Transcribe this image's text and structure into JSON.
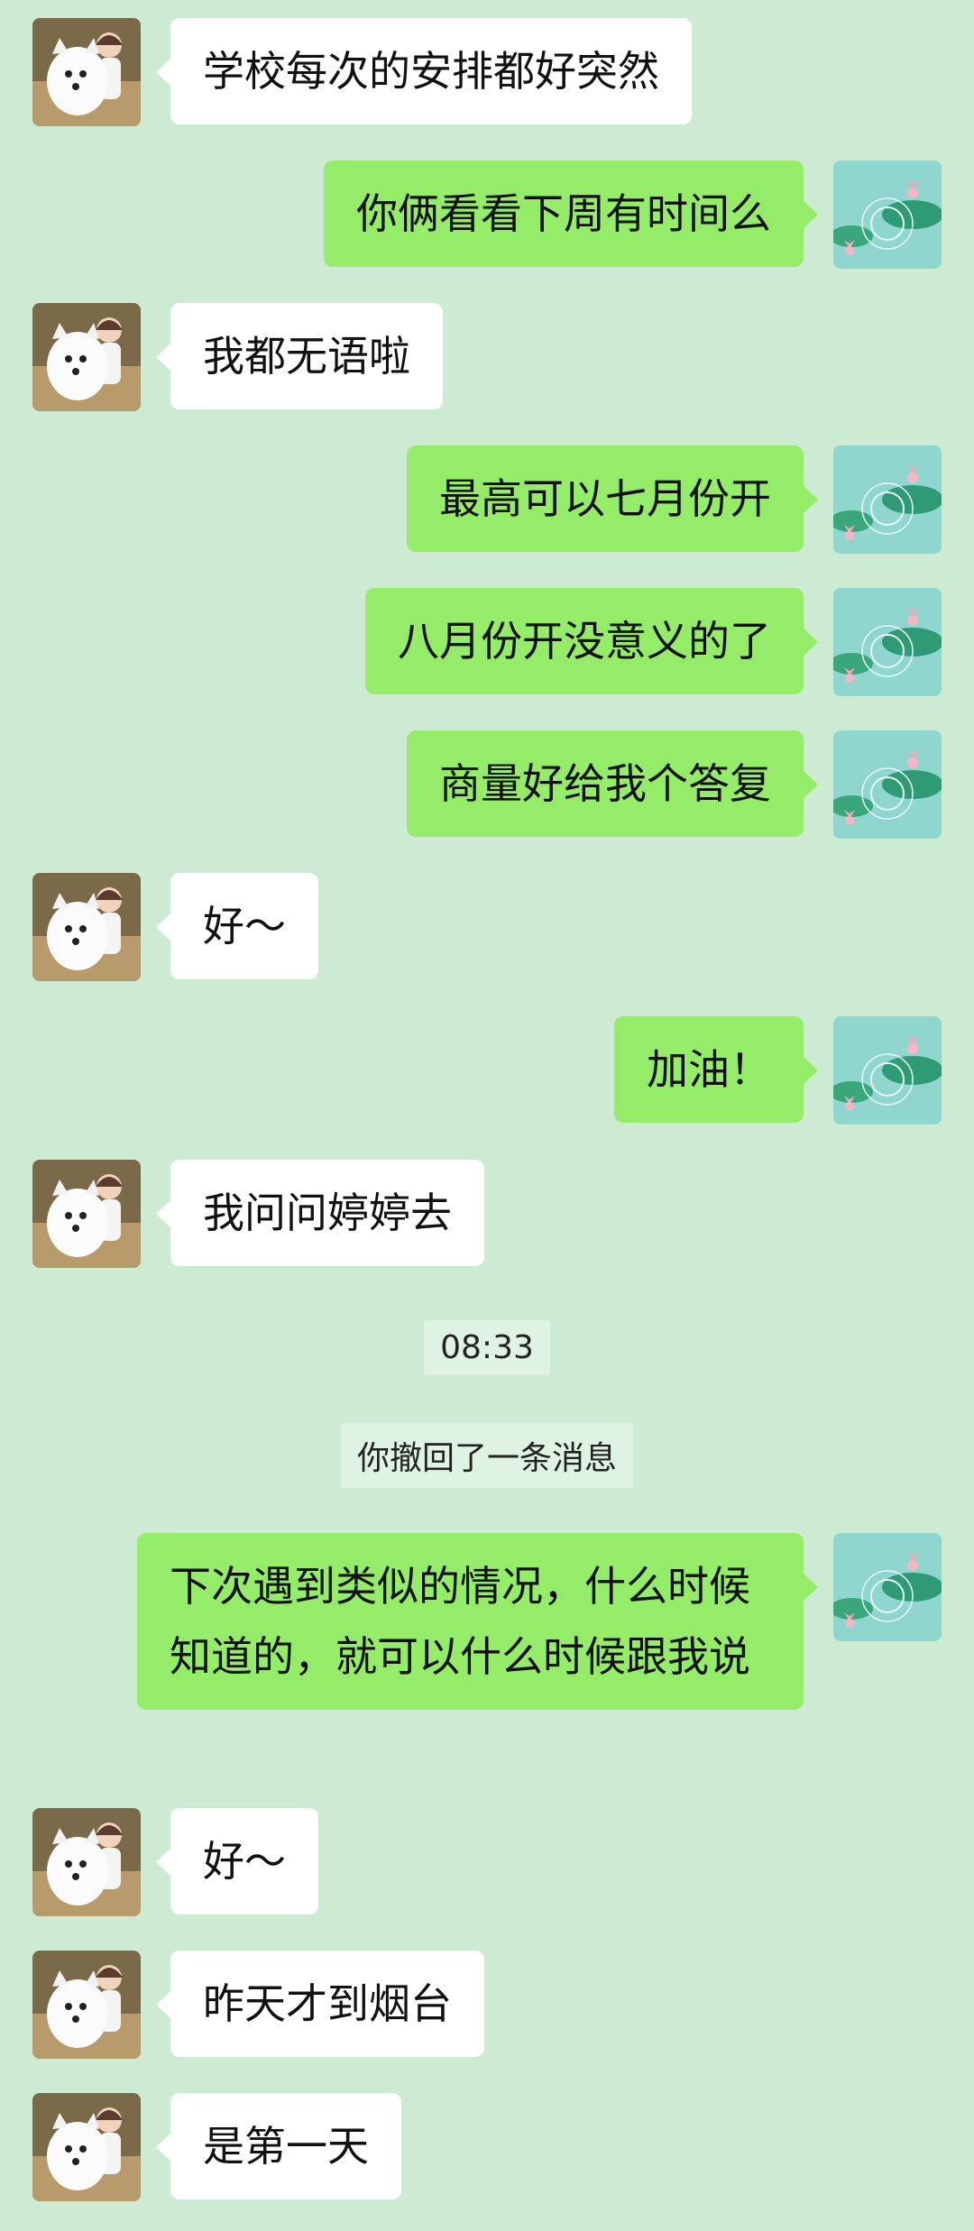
{
  "icons": {
    "contact_avatar": "girl-with-samoyed-avatar-icon",
    "self_avatar": "lotus-pond-avatar-icon"
  },
  "colors": {
    "background": "#cdebd3",
    "incoming_bubble": "#ffffff",
    "outgoing_bubble": "#95ec69"
  },
  "messages": [
    {
      "side": "left",
      "text": "学校每次的安排都好突然"
    },
    {
      "side": "right",
      "text": "你俩看看下周有时间么"
    },
    {
      "side": "left",
      "text": "我都无语啦"
    },
    {
      "side": "right",
      "text": "最高可以七月份开"
    },
    {
      "side": "right",
      "text": "八月份开没意义的了"
    },
    {
      "side": "right",
      "text": "商量好给我个答复"
    },
    {
      "side": "left",
      "text": "好～"
    },
    {
      "side": "right",
      "text": "加油！"
    },
    {
      "side": "left",
      "text": "我问问婷婷去"
    },
    {
      "side": "right",
      "text": "下次遇到类似的情况，什么时候知道的，就可以什么时候跟我说"
    },
    {
      "side": "left",
      "text": "好～"
    },
    {
      "side": "left",
      "text": "昨天才到烟台"
    },
    {
      "side": "left",
      "text": "是第一天"
    }
  ],
  "timestamp": "08:33",
  "recall_notice": "你撤回了一条消息"
}
